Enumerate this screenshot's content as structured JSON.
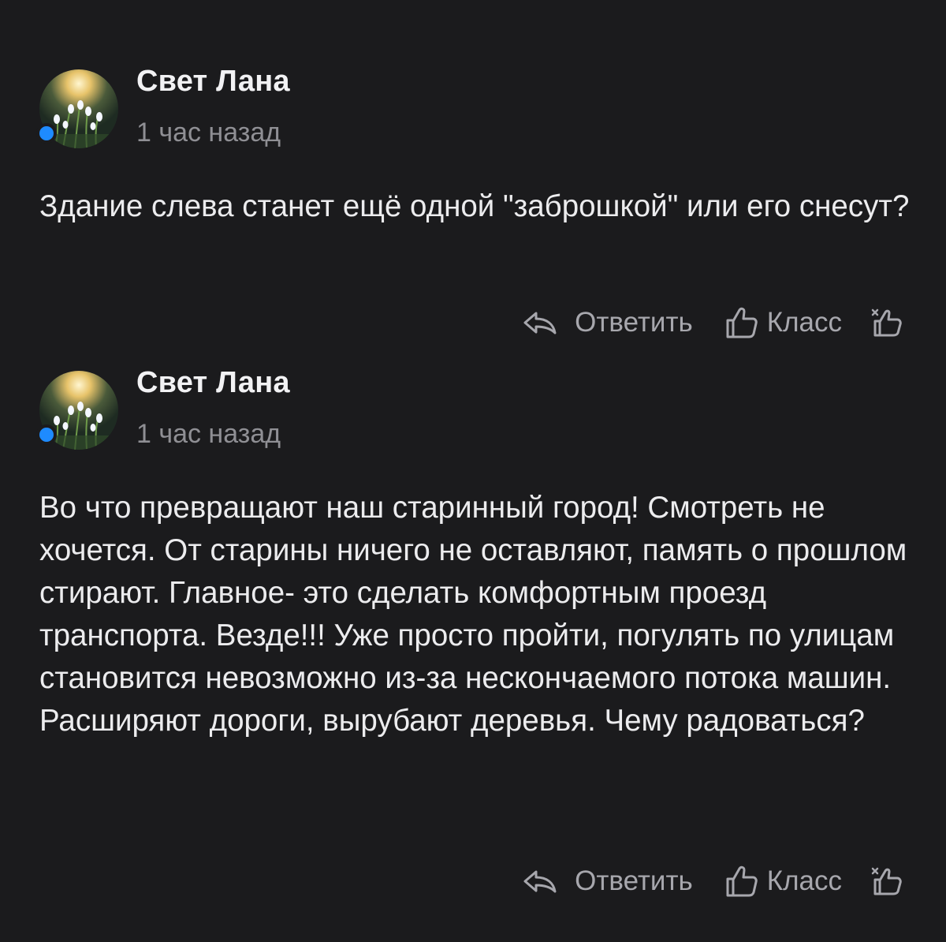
{
  "comments": [
    {
      "author": "Свет Лана",
      "time": "1 час назад",
      "text": "Здание слева станет ещё одной \"заброшкой\" или его снесут?",
      "actions": {
        "reply_label": "Ответить",
        "like_label": "Класс"
      }
    },
    {
      "author": "Свет Лана",
      "time": "1 час назад",
      "text": "Во что превращают наш старинный город! Смотреть не хочется. От старины ничего не оставляют, память о прошлом стирают. Главное- это сделать комфортным проезд транспорта. Везде!!! Уже просто пройти, погулять по улицам становится невозможно из-за нескончаемого потока машин. Расширяют дороги, вырубают деревья. Чему радоваться?",
      "actions": {
        "reply_label": "Ответить",
        "like_label": "Класс"
      }
    }
  ],
  "icons": {
    "reply": "reply-arrow-icon",
    "like": "thumbs-up-icon",
    "react": "thumbs-up-plus-icon",
    "online": "online-status-dot"
  },
  "colors": {
    "background": "#1b1b1d",
    "text": "#ececee",
    "muted": "#8f8f94",
    "action": "#a7a7ad",
    "online": "#1e8bff"
  }
}
